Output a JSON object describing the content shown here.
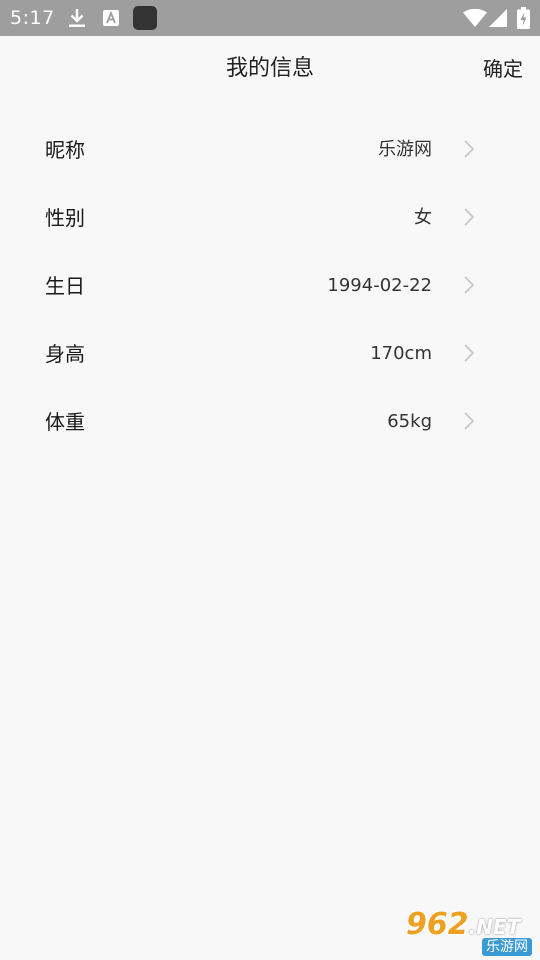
{
  "status_bar": {
    "time": "5:17",
    "icons": [
      "download-icon",
      "a-notification-icon",
      "app-square-icon",
      "wifi-icon",
      "signal-icon",
      "battery-charging-icon"
    ]
  },
  "header": {
    "title": "我的信息",
    "confirm_label": "确定"
  },
  "fields": [
    {
      "label": "昵称",
      "value": "乐游网"
    },
    {
      "label": "性别",
      "value": "女"
    },
    {
      "label": "生日",
      "value": "1994-02-22"
    },
    {
      "label": "身高",
      "value": "170cm"
    },
    {
      "label": "体重",
      "value": "65kg"
    }
  ],
  "watermark": {
    "brand": "962",
    "brand_suffix": ".NET",
    "sub": "乐游网"
  },
  "colors": {
    "status_bar": "#9e9e9e",
    "background": "#f8f8f8",
    "chevron": "#c4c4c4",
    "watermark_orange": "#f0a020",
    "watermark_blue": "#3a9bd6"
  }
}
